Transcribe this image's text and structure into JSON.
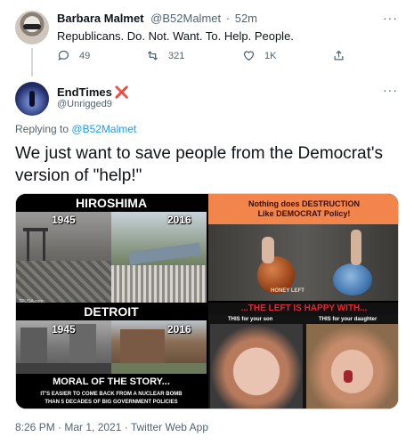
{
  "parent_tweet": {
    "display_name": "Barbara Malmet",
    "handle": "@B52Malmet",
    "separator": "·",
    "time": "52m",
    "text": "Republicans. Do. Not. Want. To. Help. People.",
    "actions": {
      "reply_count": "49",
      "retweet_count": "321",
      "like_count": "1K"
    },
    "more": "···"
  },
  "main_tweet": {
    "display_name": "EndTimes",
    "badge": "❌",
    "handle": "@Unrigged9",
    "more": "···",
    "replying_prefix": "Replying to",
    "replying_handle": "@B52Malmet",
    "text": "We just want to save people from the Democrat's version of \"help!\"",
    "footer": "8:26 PM · Mar 1, 2021 · Twitter Web App"
  },
  "media": {
    "left": {
      "header_top": "HIROSHIMA",
      "year_a": "1945",
      "year_b": "2016",
      "credit": "TPUSA.com",
      "header_mid": "DETROIT",
      "year_c": "1945",
      "year_d": "2016",
      "moral_title": "MORAL OF THE STORY...",
      "moral_line1": "IT'S EASIER TO COME BACK FROM A NUCLEAR BOMB",
      "moral_line2": "THAN 5 DECADES OF BIG GOVERNMENT POLICIES"
    },
    "top_right": {
      "line1": "Nothing does DESTRUCTION",
      "line2": "Like DEMOCRAT Policy!",
      "ball_text": "HONEY LEFT"
    },
    "bottom_right": {
      "header": "...THE LEFT IS HAPPY WITH...",
      "cap_son": "THIS for your son",
      "cap_daughter": "THIS for your daughter"
    }
  },
  "colors": {
    "link": "#1d9bf0",
    "muted": "#536471",
    "badge_red": "#e0245e"
  }
}
